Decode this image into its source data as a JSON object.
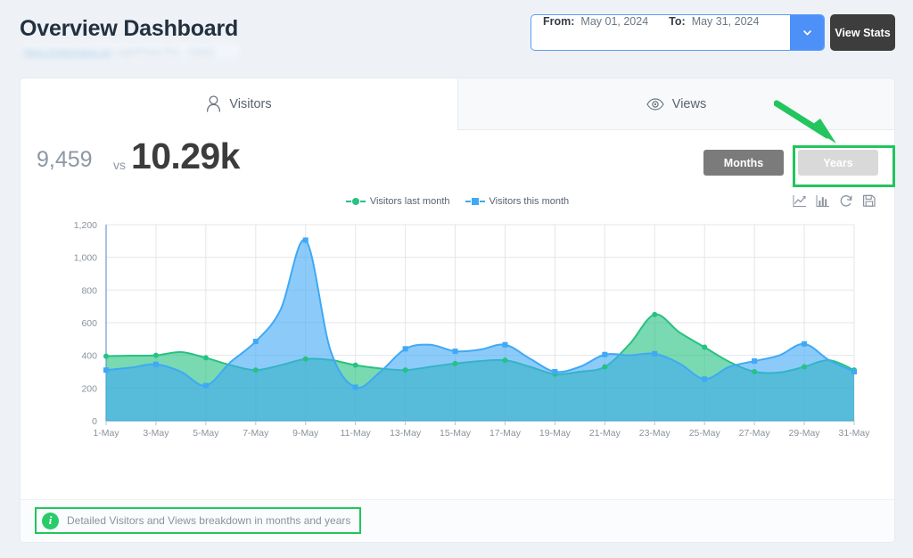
{
  "header": {
    "title": "Overview Dashboard",
    "subtitle_link": "https://mdomains.es",
    "subtitle_rest": "LoginPress Pro - SAAS",
    "subtitle_redacted": true
  },
  "daterange": {
    "from_label": "From:",
    "from_value": "May 01, 2024",
    "to_label": "To:",
    "to_value": "May 31, 2024",
    "caret_icon": "chevron-down-icon",
    "accent_color": "#4d90f7"
  },
  "view_stats_button": {
    "label": "View Stats",
    "color": "#3d3d3d"
  },
  "tabs": [
    {
      "label": "Visitors",
      "icon": "user-icon",
      "active": true
    },
    {
      "label": "Views",
      "icon": "eye-icon",
      "active": false
    }
  ],
  "stats": {
    "previous_value": "9,459",
    "vs_label": "vs",
    "current_value": "10.29k"
  },
  "range_buttons": [
    {
      "label": "Months",
      "active": true,
      "color": "#7b7b7b"
    },
    {
      "label": "Years",
      "active": false,
      "color": "#d9d9d9"
    }
  ],
  "chart_tools": [
    {
      "name": "line-chart-icon"
    },
    {
      "name": "bar-chart-icon"
    },
    {
      "name": "reset-zoom-icon"
    },
    {
      "name": "save-icon"
    }
  ],
  "footer_note": {
    "icon": "info-icon",
    "text": "Detailed Visitors and Views breakdown in months and years"
  },
  "annotations": {
    "highlight_color": "#22c55e",
    "arrow_target": "Years",
    "box_targets": [
      "Years",
      "footer-note"
    ]
  },
  "chart_data": {
    "type": "area",
    "title": "",
    "xlabel": "",
    "ylabel": "",
    "ylim": [
      0,
      1200
    ],
    "yticks": [
      0,
      200,
      400,
      600,
      800,
      1000,
      1200
    ],
    "ytick_labels": [
      "0",
      "200",
      "400",
      "600",
      "800",
      "1,000",
      "1,200"
    ],
    "grid": true,
    "legend_position": "top-center",
    "smooth": true,
    "x": [
      "1-May",
      "2-May",
      "3-May",
      "4-May",
      "5-May",
      "6-May",
      "7-May",
      "8-May",
      "9-May",
      "10-May",
      "11-May",
      "12-May",
      "13-May",
      "14-May",
      "15-May",
      "16-May",
      "17-May",
      "18-May",
      "19-May",
      "20-May",
      "21-May",
      "22-May",
      "23-May",
      "24-May",
      "25-May",
      "26-May",
      "27-May",
      "28-May",
      "29-May",
      "30-May",
      "31-May"
    ],
    "xtick_labels": [
      "1-May",
      "3-May",
      "5-May",
      "7-May",
      "9-May",
      "11-May",
      "13-May",
      "15-May",
      "17-May",
      "19-May",
      "21-May",
      "23-May",
      "25-May",
      "27-May",
      "29-May",
      "31-May"
    ],
    "series": [
      {
        "name": "Visitors last month",
        "color": "#26c281",
        "marker": "circle",
        "values": [
          395,
          398,
          400,
          420,
          385,
          340,
          310,
          340,
          378,
          372,
          340,
          320,
          310,
          330,
          350,
          365,
          370,
          330,
          285,
          300,
          330,
          470,
          650,
          540,
          450,
          360,
          300,
          295,
          330,
          370,
          310
        ]
      },
      {
        "name": "Visitors this month",
        "color": "#3fa9f5",
        "marker": "square",
        "values": [
          310,
          325,
          345,
          300,
          215,
          360,
          485,
          680,
          1105,
          430,
          205,
          300,
          440,
          465,
          425,
          435,
          465,
          380,
          300,
          330,
          405,
          400,
          410,
          350,
          255,
          330,
          365,
          400,
          470,
          370,
          300
        ]
      }
    ]
  }
}
